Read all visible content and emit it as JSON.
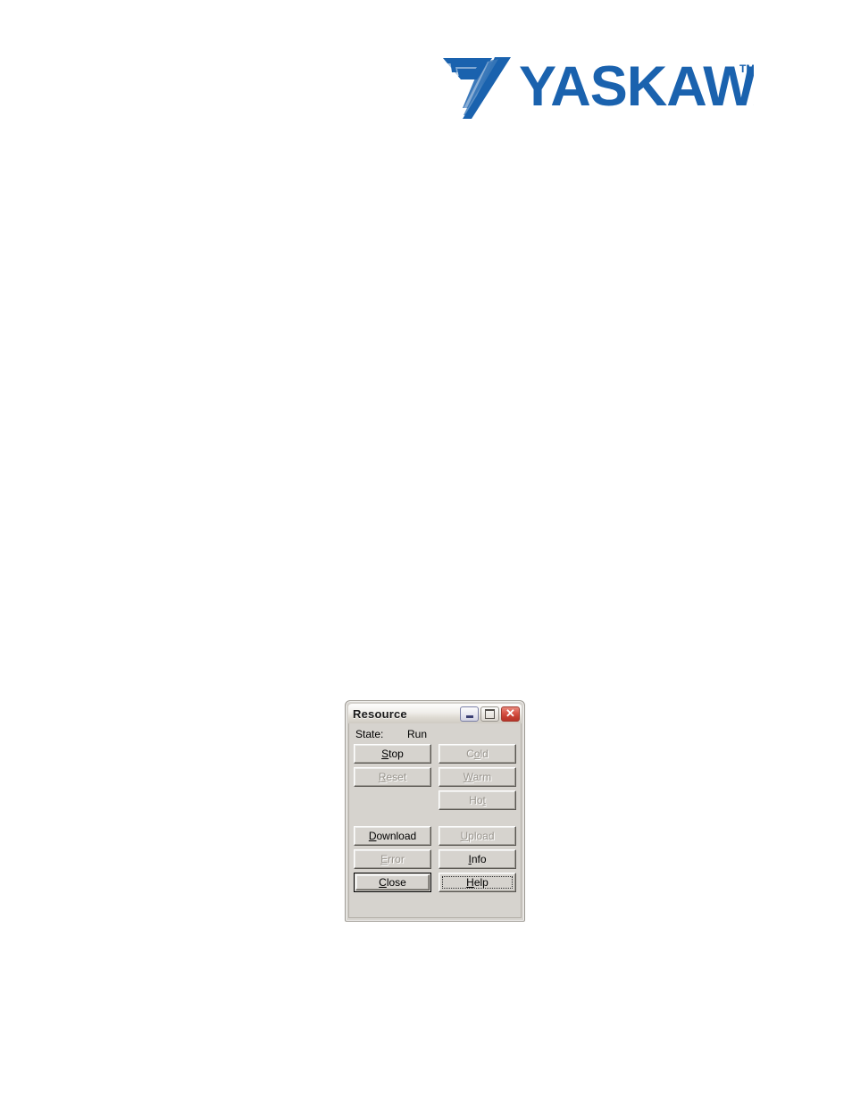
{
  "page": {
    "background": "#ffffff"
  },
  "logo": {
    "name": "yaskawa-logo",
    "wordmark": "YASKAWA",
    "trademark": "TM",
    "color": "#1a62ae"
  },
  "dialog": {
    "title": "Resource",
    "window_controls": [
      {
        "name": "minimize-button",
        "glyph": "–",
        "tooltip": "Minimize"
      },
      {
        "name": "maximize-button",
        "glyph": "□",
        "tooltip": "Maximize"
      },
      {
        "name": "close-button",
        "glyph": "✕",
        "tooltip": "Close",
        "color": "#c33c2e"
      }
    ],
    "state": {
      "label": "State:",
      "value": "Run"
    },
    "buttons": [
      {
        "name": "stop-button",
        "label": "Stop",
        "mnemonic": "S",
        "before": "",
        "after": "top",
        "enabled": true,
        "column": "left",
        "row": 1
      },
      {
        "name": "cold-button",
        "label": "Cold",
        "mnemonic": "o",
        "before": "C",
        "after": "ld",
        "enabled": false,
        "column": "right",
        "row": 1
      },
      {
        "name": "reset-button",
        "label": "Reset",
        "mnemonic": "R",
        "before": "",
        "after": "eset",
        "enabled": false,
        "column": "left",
        "row": 2
      },
      {
        "name": "warm-button",
        "label": "Warm",
        "mnemonic": "W",
        "before": "",
        "after": "arm",
        "enabled": false,
        "column": "right",
        "row": 2
      },
      {
        "name": "hot-button",
        "label": "Hot",
        "mnemonic": "t",
        "before": "Ho",
        "after": "",
        "enabled": false,
        "column": "right",
        "row": 3
      },
      {
        "name": "download-button",
        "label": "Download",
        "mnemonic": "D",
        "before": "",
        "after": "ownload",
        "enabled": true,
        "column": "left",
        "row": 4
      },
      {
        "name": "upload-button",
        "label": "Upload",
        "mnemonic": "U",
        "before": "",
        "after": "pload",
        "enabled": false,
        "column": "right",
        "row": 4
      },
      {
        "name": "error-button",
        "label": "Error",
        "mnemonic": "E",
        "before": "",
        "after": "rror",
        "enabled": false,
        "column": "left",
        "row": 5
      },
      {
        "name": "info-button",
        "label": "Info",
        "mnemonic": "I",
        "before": "",
        "after": "nfo",
        "enabled": true,
        "column": "right",
        "row": 5
      },
      {
        "name": "close-dialog-button",
        "label": "Close",
        "mnemonic": "C",
        "before": "",
        "after": "lose",
        "enabled": true,
        "is_default": true,
        "column": "left",
        "row": 6
      },
      {
        "name": "help-button",
        "label": "Help",
        "mnemonic": "H",
        "before": "",
        "after": "elp",
        "enabled": true,
        "has_focus": true,
        "column": "right",
        "row": 6
      }
    ]
  }
}
